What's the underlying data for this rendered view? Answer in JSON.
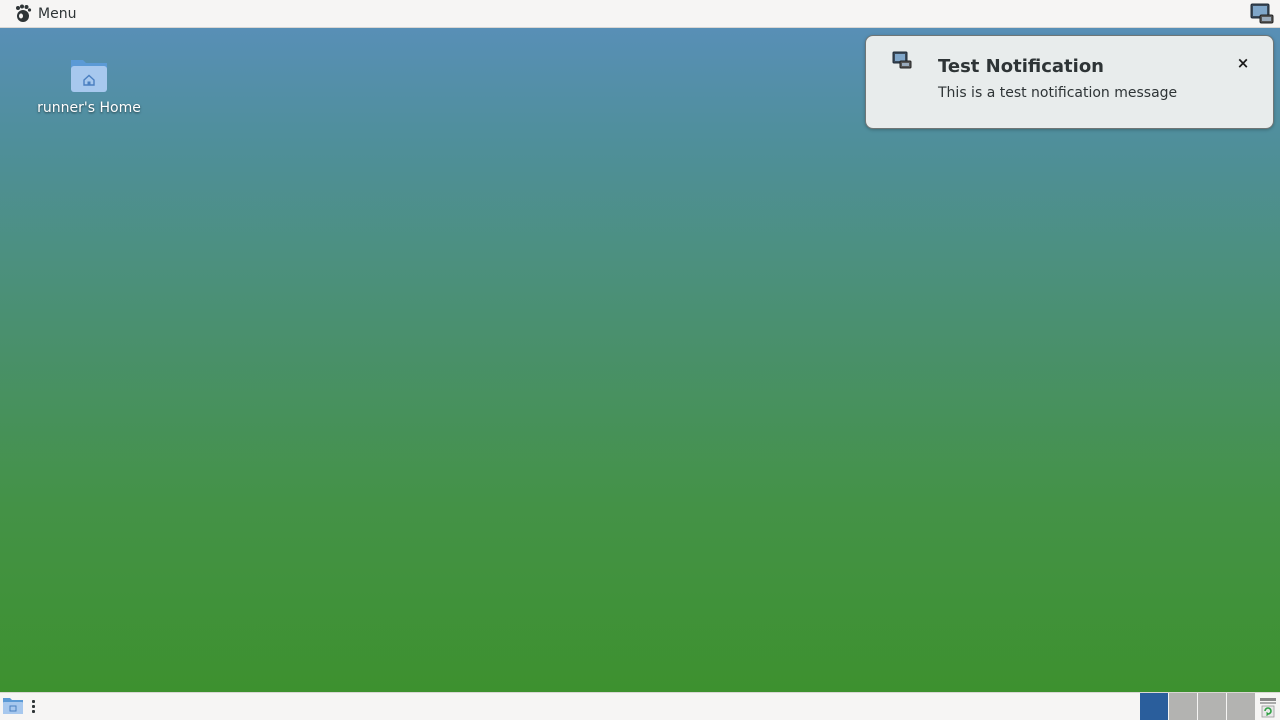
{
  "top_panel": {
    "menu_label": "Menu",
    "menu_icon": "gnome-foot-icon",
    "tray_icon": "network-monitor-icon"
  },
  "desktop": {
    "icons": [
      {
        "label": "runner's Home",
        "icon": "home-folder-icon"
      }
    ]
  },
  "notification": {
    "title": "Test Notification",
    "body": "This is a test notification message",
    "icon": "computer-icon",
    "close_glyph": "×"
  },
  "bottom_panel": {
    "workspaces": [
      {
        "active": true
      },
      {
        "active": false
      },
      {
        "active": false
      },
      {
        "active": false
      }
    ],
    "trash_icon": "trash-icon"
  },
  "colors": {
    "panel_bg": "#f6f5f4",
    "active_workspace": "#2a5e9c",
    "inactive_workspace": "#b3b3b1",
    "desktop_top": "#5a8fbd",
    "desktop_bottom": "#3c912b"
  }
}
